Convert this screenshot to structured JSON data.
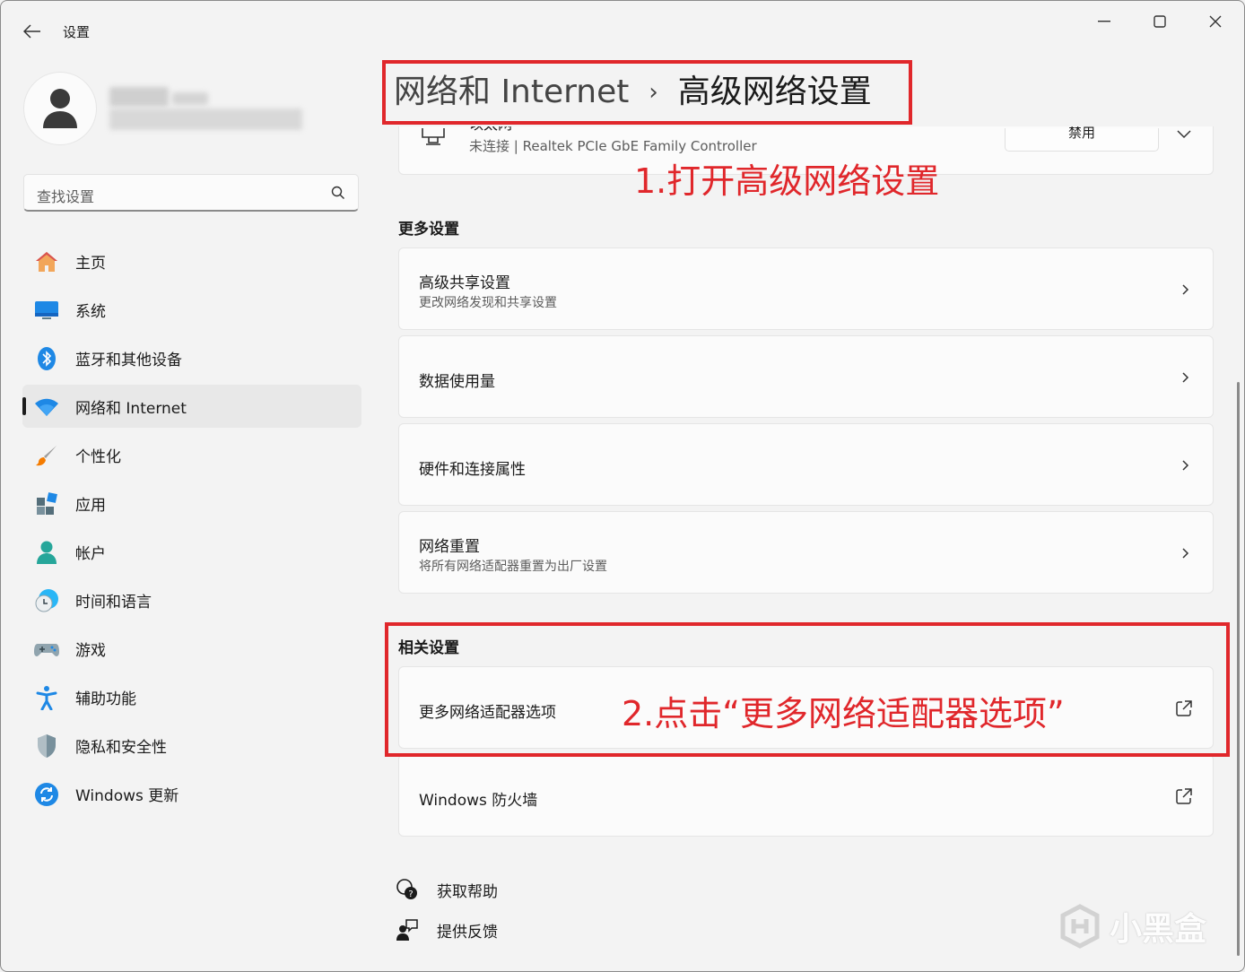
{
  "app": {
    "title": "设置"
  },
  "window_controls": {
    "minimize": "minimize",
    "maximize": "maximize",
    "close": "close"
  },
  "search": {
    "placeholder": "查找设置"
  },
  "sidebar": {
    "items": [
      {
        "label": "主页",
        "icon": "home-icon"
      },
      {
        "label": "系统",
        "icon": "system-icon"
      },
      {
        "label": "蓝牙和其他设备",
        "icon": "bluetooth-icon"
      },
      {
        "label": "网络和 Internet",
        "icon": "wifi-icon",
        "active": true
      },
      {
        "label": "个性化",
        "icon": "brush-icon"
      },
      {
        "label": "应用",
        "icon": "apps-icon"
      },
      {
        "label": "帐户",
        "icon": "account-icon"
      },
      {
        "label": "时间和语言",
        "icon": "time-language-icon"
      },
      {
        "label": "游戏",
        "icon": "gaming-icon"
      },
      {
        "label": "辅助功能",
        "icon": "accessibility-icon"
      },
      {
        "label": "隐私和安全性",
        "icon": "privacy-shield-icon"
      },
      {
        "label": "Windows 更新",
        "icon": "update-icon"
      }
    ]
  },
  "breadcrumb": {
    "parent": "网络和 Internet",
    "separator": "›",
    "current": "高级网络设置"
  },
  "adapter": {
    "name": "以太网",
    "status": "未连接 | Realtek PCIe GbE Family Controller",
    "button": "禁用"
  },
  "more_settings": {
    "title": "更多设置",
    "items": [
      {
        "title": "高级共享设置",
        "subtitle": "更改网络发现和共享设置"
      },
      {
        "title": "数据使用量"
      },
      {
        "title": "硬件和连接属性"
      },
      {
        "title": "网络重置",
        "subtitle": "将所有网络适配器重置为出厂设置"
      }
    ]
  },
  "related_settings": {
    "title": "相关设置",
    "items": [
      {
        "title": "更多网络适配器选项"
      },
      {
        "title": "Windows 防火墙"
      }
    ]
  },
  "footer": {
    "help": "获取帮助",
    "feedback": "提供反馈"
  },
  "annotations": {
    "step1": "1.打开高级网络设置",
    "step2": "2.点击“更多网络适配器选项”",
    "color": "#e0272b"
  },
  "watermark": "小黑盒"
}
